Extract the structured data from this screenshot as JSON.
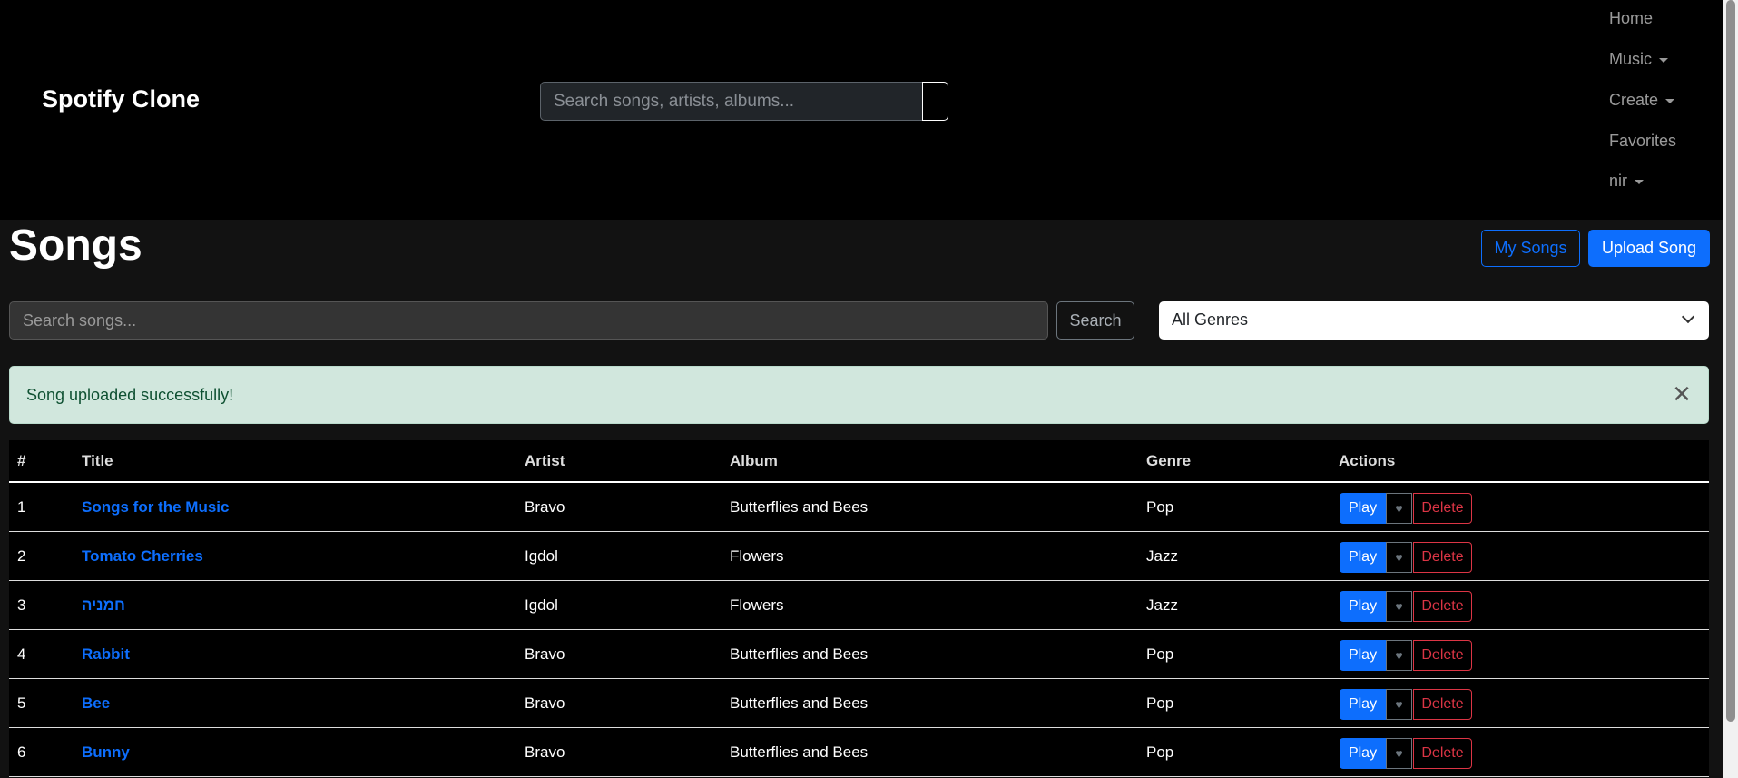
{
  "header": {
    "logo": "Spotify Clone",
    "search_placeholder": "Search songs, artists, albums...",
    "nav": [
      {
        "label": "Home",
        "dropdown": false
      },
      {
        "label": "Music",
        "dropdown": true
      },
      {
        "label": "Create",
        "dropdown": true
      },
      {
        "label": "Favorites",
        "dropdown": false
      },
      {
        "label": "nir",
        "dropdown": true
      }
    ]
  },
  "page": {
    "title": "Songs",
    "my_songs": "My Songs",
    "upload_song": "Upload Song",
    "search_placeholder": "Search songs...",
    "search_button": "Search",
    "genre_selected": "All Genres"
  },
  "alert": {
    "message": "Song uploaded successfully!",
    "close": "×"
  },
  "table": {
    "headers": [
      "#",
      "Title",
      "Artist",
      "Album",
      "Genre",
      "Actions"
    ],
    "rows": [
      {
        "n": "1",
        "title": "Songs for the Music",
        "artist": "Bravo",
        "album": "Butterflies and Bees",
        "genre": "Pop"
      },
      {
        "n": "2",
        "title": "Tomato Cherries",
        "artist": "Igdol",
        "album": "Flowers",
        "genre": "Jazz"
      },
      {
        "n": "3",
        "title": "חמניה",
        "artist": "Igdol",
        "album": "Flowers",
        "genre": "Jazz"
      },
      {
        "n": "4",
        "title": "Rabbit",
        "artist": "Bravo",
        "album": "Butterflies and Bees",
        "genre": "Pop"
      },
      {
        "n": "5",
        "title": "Bee",
        "artist": "Bravo",
        "album": "Butterflies and Bees",
        "genre": "Pop"
      },
      {
        "n": "6",
        "title": "Bunny",
        "artist": "Bravo",
        "album": "Butterflies and Bees",
        "genre": "Pop"
      }
    ],
    "play_label": "Play",
    "heart": "♥",
    "delete_label": "Delete"
  }
}
